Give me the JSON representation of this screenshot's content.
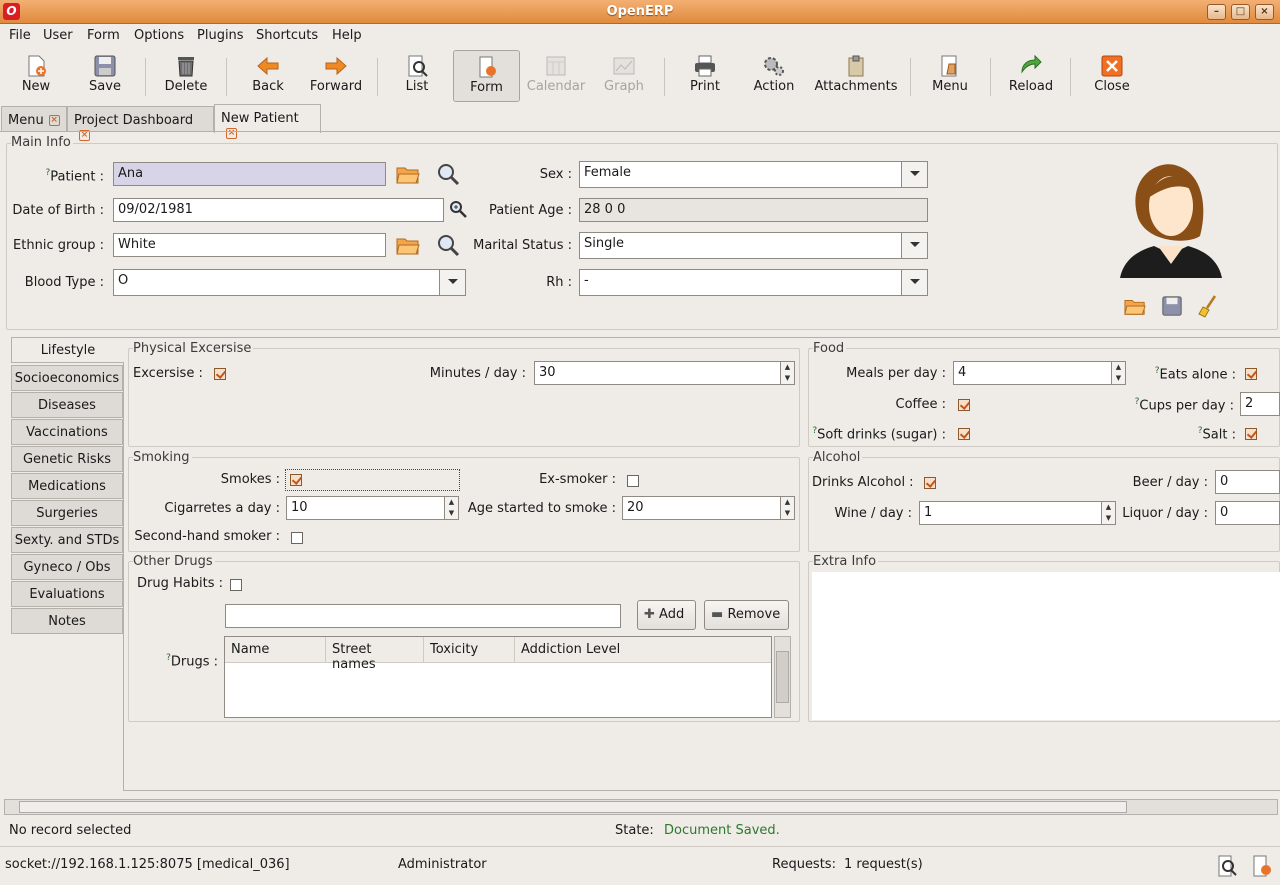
{
  "window": {
    "title": "OpenERP",
    "app_icon": "O"
  },
  "menu": [
    "File",
    "User",
    "Form",
    "Options",
    "Plugins",
    "Shortcuts",
    "Help"
  ],
  "toolbar": {
    "new": "New",
    "save": "Save",
    "delete": "Delete",
    "back": "Back",
    "forward": "Forward",
    "list": "List",
    "form": "Form",
    "calendar": "Calendar",
    "graph": "Graph",
    "print": "Print",
    "action": "Action",
    "attachments": "Attachments",
    "menu": "Menu",
    "reload": "Reload",
    "close": "Close"
  },
  "tabs": [
    {
      "label": "Menu"
    },
    {
      "label": "Project Dashboard"
    },
    {
      "label": "New Patient"
    }
  ],
  "main_info": {
    "section": "Main Info",
    "patient_label": "Patient :",
    "patient_value": "Ana",
    "dob_label": "Date of Birth :",
    "dob_value": "09/02/1981",
    "ethnic_label": "Ethnic group :",
    "ethnic_value": "White",
    "blood_label": "Blood Type :",
    "blood_value": "O",
    "sex_label": "Sex :",
    "sex_value": "Female",
    "age_label": "Patient Age :",
    "age_value": "28 0  0",
    "marital_label": "Marital Status :",
    "marital_value": "Single",
    "rh_label": "Rh :",
    "rh_value": "-"
  },
  "side_tabs": [
    "Lifestyle",
    "Socioeconomics",
    "Diseases",
    "Vaccinations",
    "Genetic Risks",
    "Medications",
    "Surgeries",
    "Sexty. and STDs",
    "Gyneco / Obs",
    "Evaluations",
    "Notes"
  ],
  "physical": {
    "section": "Physical Excersise",
    "excersise_label": "Excersise :",
    "excersise_checked": true,
    "minutes_label": "Minutes / day :",
    "minutes_value": "30"
  },
  "food": {
    "section": "Food",
    "meals_label": "Meals per day :",
    "meals_value": "4",
    "eats_alone_label": "Eats alone :",
    "eats_alone": true,
    "coffee_label": "Coffee :",
    "coffee": true,
    "cups_label": "Cups per day :",
    "cups_value": "2",
    "soft_label": "Soft drinks (sugar) :",
    "soft": true,
    "salt_label": "Salt :",
    "salt": true
  },
  "smoking": {
    "section": "Smoking",
    "smokes_label": "Smokes :",
    "smokes": true,
    "exsmoker_label": "Ex-smoker :",
    "exsmoker": false,
    "cig_label": "Cigarretes a day :",
    "cig_value": "10",
    "age_label": "Age started to smoke :",
    "age_value": "20",
    "second_label": "Second-hand smoker :",
    "second": false
  },
  "alcohol": {
    "section": "Alcohol",
    "drinks_label": "Drinks Alcohol :",
    "drinks": true,
    "beer_label": "Beer / day :",
    "beer_value": "0",
    "wine_label": "Wine / day :",
    "wine_value": "1",
    "liquor_label": "Liquor / day :",
    "liquor_value": "0"
  },
  "drugs": {
    "section": "Other Drugs",
    "habits_label": "Drug Habits :",
    "habits": false,
    "add": "Add",
    "remove": "Remove",
    "drugs_label": "Drugs :",
    "columns": [
      "Name",
      "Street names",
      "Toxicity",
      "Addiction Level"
    ]
  },
  "extra": {
    "section": "Extra Info"
  },
  "status": {
    "record": "No record selected",
    "state_label": "State:",
    "state_value": "Document Saved.",
    "server": "socket://192.168.1.125:8075 [medical_036]",
    "user": "Administrator",
    "requests_label": "Requests:",
    "requests_value": "1 request(s)"
  },
  "colors": {
    "accent": "#e08a3c",
    "required": "#d8d4e8",
    "saved_text": "#2d7a2d"
  }
}
